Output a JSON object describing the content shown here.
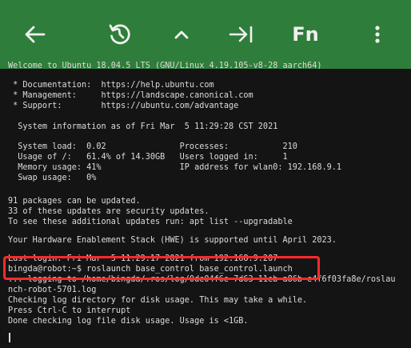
{
  "toolbar": {
    "fn_label": "Fn"
  },
  "terminal": {
    "lines": [
      "Welcome to Ubuntu 18.04.5 LTS (GNU/Linux 4.19.105-v8-28 aarch64)",
      "",
      " * Documentation:  https://help.ubuntu.com",
      " * Management:     https://landscape.canonical.com",
      " * Support:        https://ubuntu.com/advantage",
      "",
      "  System information as of Fri Mar  5 11:29:28 CST 2021",
      "",
      "  System load:  0.02               Processes:           210",
      "  Usage of /:   61.4% of 14.30GB   Users logged in:     1",
      "  Memory usage: 41%                IP address for wlan0: 192.168.9.1",
      "  Swap usage:   0%",
      "",
      "",
      "91 packages can be updated.",
      "33 of these updates are security updates.",
      "To see these additional updates run: apt list --upgradable",
      "",
      "Your Hardware Enablement Stack (HWE) is supported until April 2023.",
      "",
      "Last login: Fri Mar  5 11:29:17 2021 from 192.168.9.207",
      "bingda@robot:~$ roslaunch base_control base_control.launch",
      "... logging to /home/bingda/.ros/log/0de04f6e-7d63-11eb-a86b-e4f6f03fa8e/roslau",
      "nch-robot-5701.log",
      "Checking log directory for disk usage. This may take a while.",
      "Press Ctrl-C to interrupt",
      "Done checking log file disk usage. Usage is <1GB."
    ]
  }
}
